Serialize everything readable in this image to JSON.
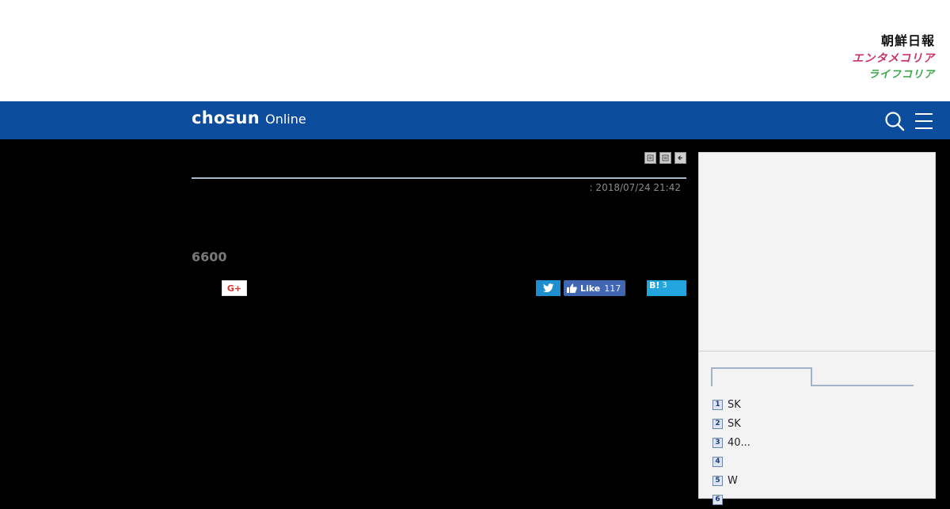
{
  "brand_links": {
    "chosun": "朝鮮日報",
    "entame": "エンタメコリア",
    "life": "ライフコリア"
  },
  "navbar": {
    "logo_main": "chosun",
    "logo_sub": "Online",
    "bg_color": "#0b4c9d",
    "search_icon": "search-icon",
    "menu_icon": "hamburger-menu-icon"
  },
  "article": {
    "date": ": 2018/07/24 21:42",
    "headline_number": "6600",
    "tool_icons": [
      "print-icon",
      "text-size-icon",
      "back-icon"
    ]
  },
  "share": {
    "gplus_label": "G+",
    "twitter_icon": "twitter-icon",
    "like_label": "Like",
    "like_count": "117",
    "hatena_label": "B!",
    "hatena_count": "3"
  },
  "ranking": {
    "items": [
      {
        "rank": "1",
        "text": "SK"
      },
      {
        "rank": "2",
        "text": "SK"
      },
      {
        "rank": "3",
        "text": "40..."
      },
      {
        "rank": "4",
        "text": ""
      },
      {
        "rank": "5",
        "text": "W"
      },
      {
        "rank": "6",
        "text": ""
      }
    ]
  }
}
